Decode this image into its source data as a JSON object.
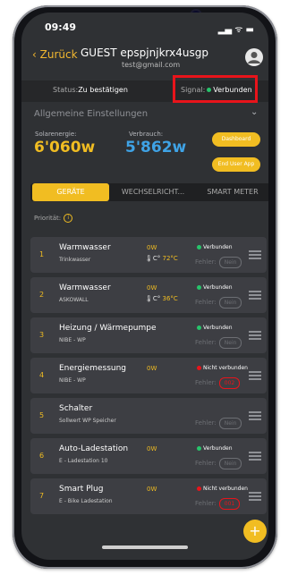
{
  "status_bar": {
    "time": "09:49",
    "icons": "▂▄ ᯤ ▬"
  },
  "header": {
    "back_label": "Zurück",
    "title": "GUEST epspjnjkrx4usgp",
    "subtitle": "test@gmail.com"
  },
  "status_row": {
    "status_label": "Status:",
    "status_value": "Zu bestätigen",
    "signal_label": "Signal:",
    "signal_value": "Verbunden"
  },
  "section": {
    "title": "Allgemeine Einstellungen"
  },
  "energy": {
    "solar_label": "Solarenergie:",
    "solar_value": "6'060w",
    "consumption_label": "Verbrauch:",
    "consumption_value": "5'862w",
    "dashboard_label": "Dashboard",
    "enduser_label": "End User App"
  },
  "tabs": [
    "GERÄTE",
    "WECHSELRICHT...",
    "SMART METER"
  ],
  "priority_label": "Priorität:",
  "devices": [
    {
      "num": "1",
      "name": "Warmwasser",
      "sub": "Trinkwasser",
      "power": "0W",
      "temp": "72°C",
      "status": "Verbunden",
      "status_color": "#27c46b",
      "error": "Nein",
      "error_red": false
    },
    {
      "num": "2",
      "name": "Warmwasser",
      "sub": "ASKOWALL",
      "power": "0W",
      "temp": "36°C",
      "status": "Verbunden",
      "status_color": "#27c46b",
      "error": "Nein",
      "error_red": false
    },
    {
      "num": "3",
      "name": "Heizung / Wärmepumpe",
      "sub": "NIBE - WP",
      "power": "",
      "temp": "",
      "status": "Verbunden",
      "status_color": "#27c46b",
      "error": "Nein",
      "error_red": false
    },
    {
      "num": "4",
      "name": "Energiemessung",
      "sub": "NIBE - WP",
      "power": "0W",
      "temp": "",
      "status": "Nicht verbunden",
      "status_color": "#e8141b",
      "error": "002",
      "error_red": true
    },
    {
      "num": "5",
      "name": "Schalter",
      "sub": "Sollwert WP Speicher",
      "power": "",
      "temp": "",
      "status": "",
      "status_color": "#27c46b",
      "error": "Nein",
      "error_red": false
    },
    {
      "num": "6",
      "name": "Auto-Ladestation",
      "sub": "E - Ladestation 10",
      "power": "0W",
      "temp": "",
      "status": "Verbunden",
      "status_color": "#27c46b",
      "error": "Nein",
      "error_red": false
    },
    {
      "num": "7",
      "name": "Smart Plug",
      "sub": "E - Bike Ladestation",
      "power": "0W",
      "temp": "",
      "status": "Nicht verbunden",
      "status_color": "#e8141b",
      "error": "001",
      "error_red": true
    }
  ],
  "fehler_label": "Fehler:",
  "fab_label": "+",
  "colors": {
    "accent": "#f1bd22",
    "online": "#27c46b",
    "offline": "#e8141b",
    "blue_value": "#3fa3e6"
  }
}
